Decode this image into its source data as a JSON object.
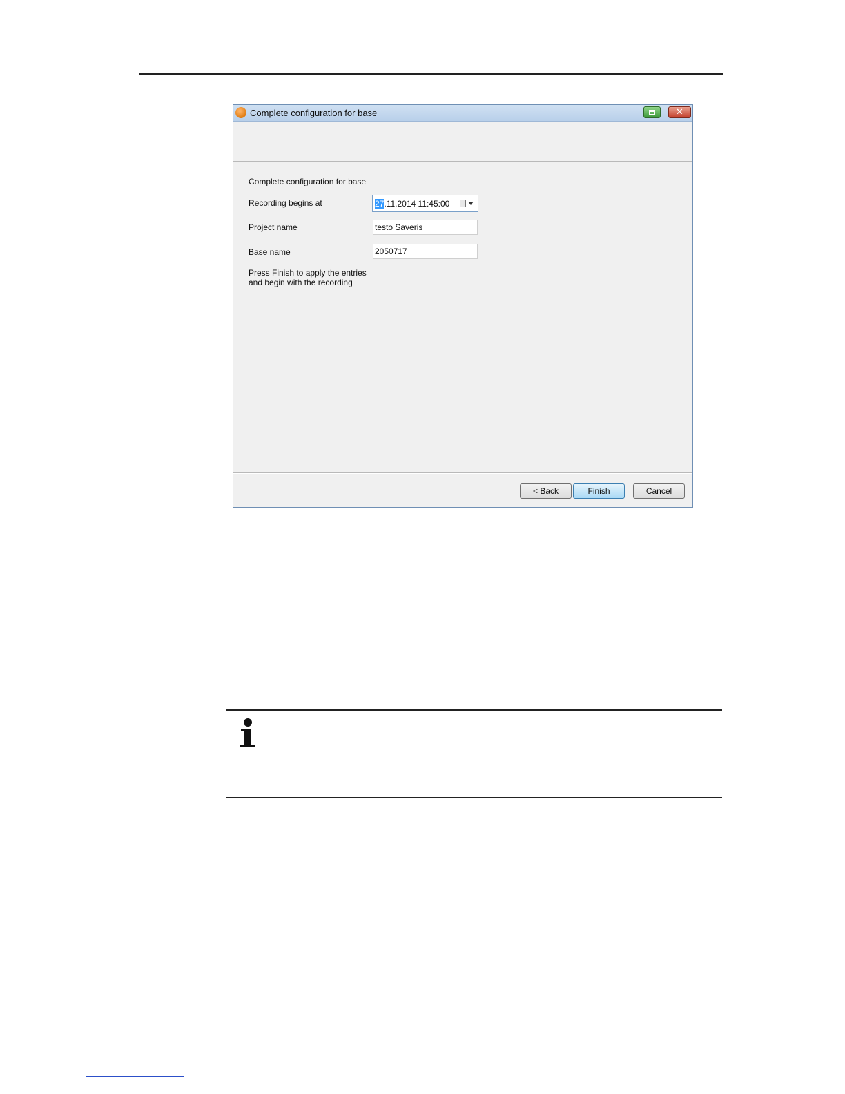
{
  "dialog": {
    "title": "Complete configuration for base",
    "heading": "Complete configuration for base",
    "recording_label": "Recording begins at",
    "recording_day_selected": "27",
    "recording_rest": ".11.2014 11:45:00",
    "project_label": "Project name",
    "project_value": "testo Saveris",
    "base_label": "Base name",
    "base_value": "2050717",
    "note": "Press Finish to apply the entries and begin with the recording",
    "buttons": {
      "back": "< Back",
      "finish": "Finish",
      "cancel": "Cancel"
    },
    "icons": {
      "app": "testo-logo-icon",
      "help": "help-icon",
      "close": "close-icon",
      "calendar": "calendar-icon",
      "dropdown": "chevron-down-icon"
    },
    "colors": {
      "titlebar": "#c4d8ee",
      "selection": "#3399ff",
      "finish_button": "#a9d9f5",
      "close_button": "#c4412d"
    }
  },
  "page": {
    "info_icon": "info-icon"
  }
}
